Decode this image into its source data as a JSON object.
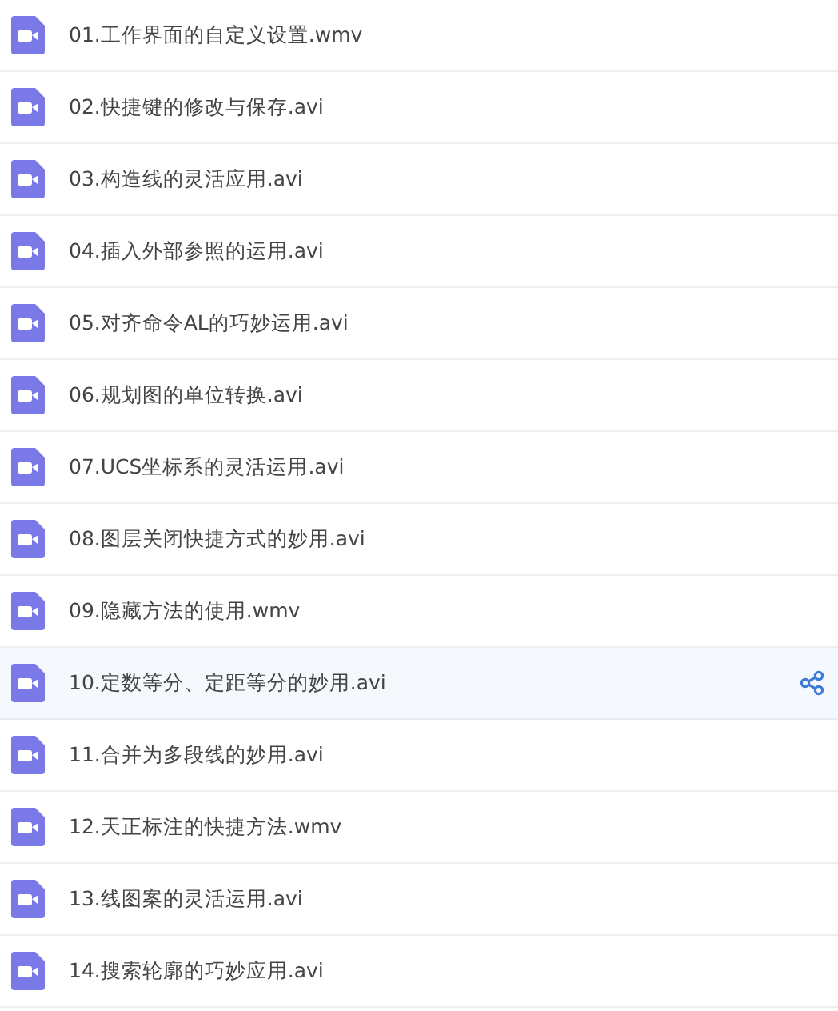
{
  "files": [
    {
      "name": "01.工作界面的自定义设置.wmv",
      "selected": false
    },
    {
      "name": "02.快捷键的修改与保存.avi",
      "selected": false
    },
    {
      "name": "03.构造线的灵活应用.avi",
      "selected": false
    },
    {
      "name": "04.插入外部参照的运用.avi",
      "selected": false
    },
    {
      "name": "05.对齐命令AL的巧妙运用.avi",
      "selected": false
    },
    {
      "name": "06.规划图的单位转换.avi",
      "selected": false
    },
    {
      "name": "07.UCS坐标系的灵活运用.avi",
      "selected": false
    },
    {
      "name": "08.图层关闭快捷方式的妙用.avi",
      "selected": false
    },
    {
      "name": "09.隐藏方法的使用.wmv",
      "selected": false
    },
    {
      "name": "10.定数等分、定距等分的妙用.avi",
      "selected": true
    },
    {
      "name": "11.合并为多段线的妙用.avi",
      "selected": false
    },
    {
      "name": "12.天正标注的快捷方法.wmv",
      "selected": false
    },
    {
      "name": "13.线图案的灵活运用.avi",
      "selected": false
    },
    {
      "name": "14.搜索轮廓的巧妙应用.avi",
      "selected": false
    }
  ]
}
